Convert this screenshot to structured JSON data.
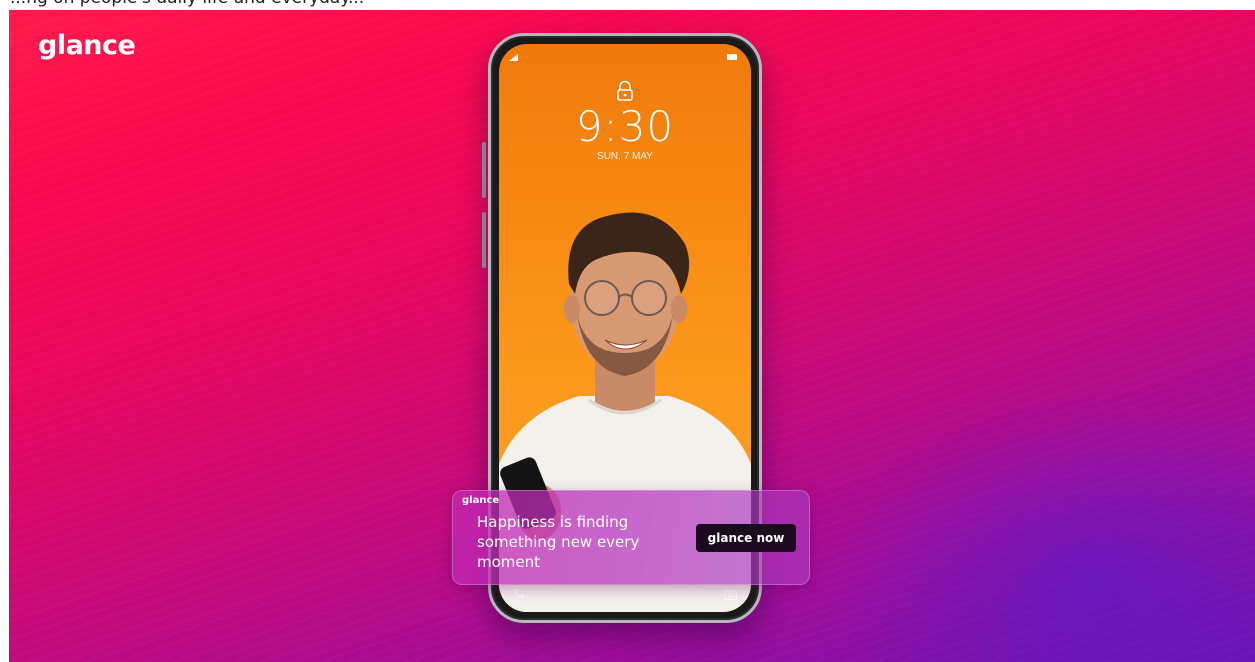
{
  "top_strip": {
    "caption": "...ng on people's daily life and everyday..."
  },
  "brand": {
    "logo_text": "glance"
  },
  "lockscreen": {
    "time": "9:30",
    "date": "SUN, 7 MAY",
    "icons": [
      "lock-icon",
      "signal-icon",
      "battery-icon",
      "call-icon",
      "camera-icon"
    ]
  },
  "notification": {
    "logo_text": "glance",
    "message": "Happiness is finding something new every moment",
    "cta_label": "glance now"
  },
  "colors": {
    "banner_start": "#ff1a4a",
    "banner_end": "#6d12b2",
    "screen_orange": "#f88c14",
    "cta_background": "#1c0a1e"
  }
}
